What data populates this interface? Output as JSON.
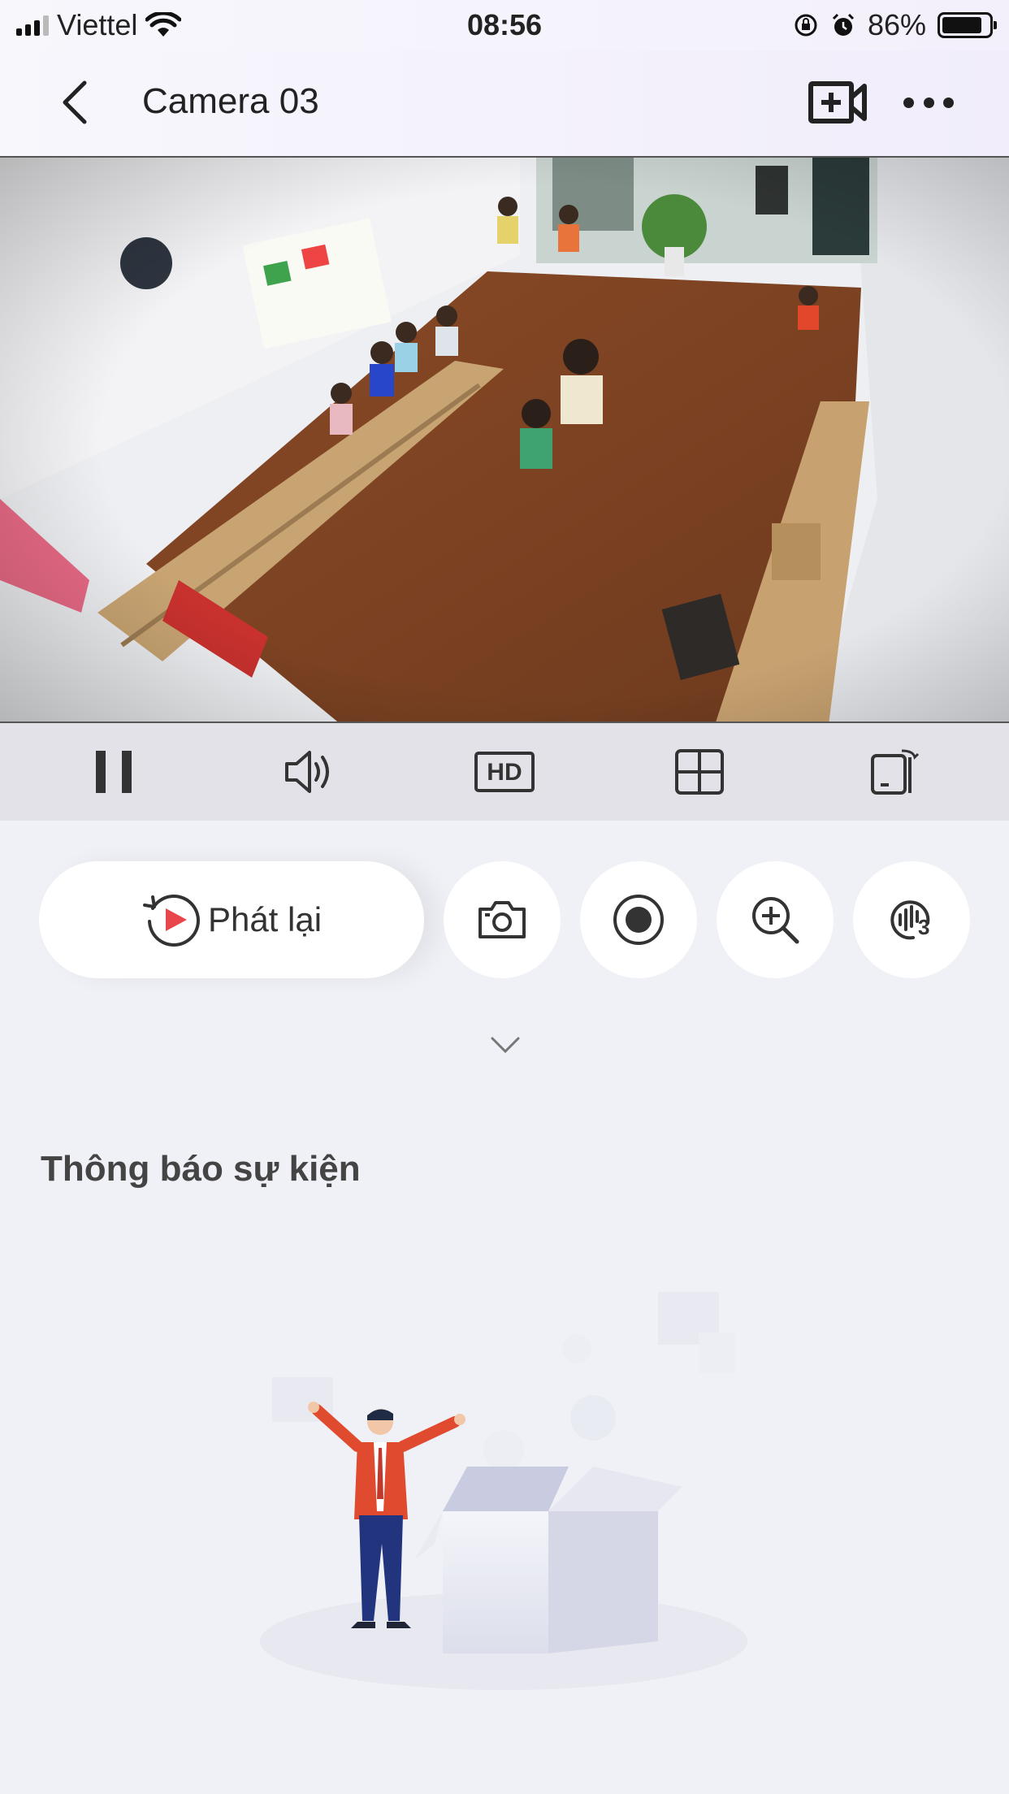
{
  "status_bar": {
    "carrier": "Viettel",
    "time": "08:56",
    "battery_percent": "86%",
    "battery_level": 0.86
  },
  "header": {
    "title": "Camera 03",
    "back_icon": "chevron-left-icon",
    "add_camera_icon": "video-plus-icon",
    "more_icon": "more-dots-icon"
  },
  "toolbar": {
    "pause_icon": "pause-icon",
    "sound_icon": "speaker-icon",
    "hd_label": "HD",
    "grid_icon": "grid-icon",
    "rotate_icon": "rotate-device-icon"
  },
  "actions": {
    "playback_label": "Phát lại",
    "snapshot_icon": "camera-icon",
    "record_icon": "record-icon",
    "zoom_icon": "zoom-in-icon",
    "voice_icon": "voice-3-icon",
    "voice_badge": "3"
  },
  "events": {
    "title": "Thông báo sự kiện"
  },
  "colors": {
    "background": "#f0f1f7",
    "toolbar_bg": "#e2e2e8",
    "accent_red": "#e8454c",
    "icon_dark": "#333333"
  }
}
